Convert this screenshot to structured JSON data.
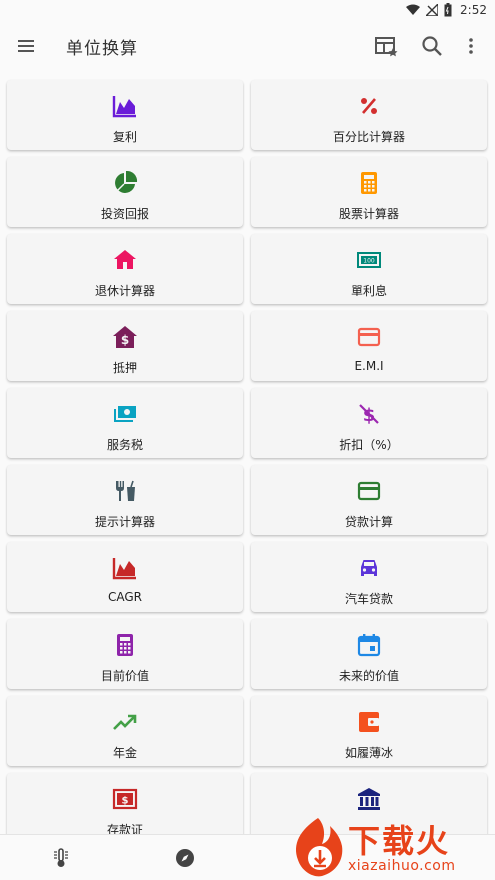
{
  "status_bar": {
    "time": "2:52"
  },
  "app_bar": {
    "title": "单位换算"
  },
  "colors": {
    "accent_purple": "#6a1cd8",
    "red": "#d32f2f",
    "orange": "#ff9800",
    "green": "#2e7d32",
    "teal": "#00897b",
    "pink": "#ec1561"
  },
  "cards": [
    {
      "label": "复利",
      "icon": "chart-area-icon"
    },
    {
      "label": "百分比计算器",
      "icon": "percent-icon"
    },
    {
      "label": "投资回报",
      "icon": "pie-chart-icon"
    },
    {
      "label": "股票计算器",
      "icon": "calculator-icon"
    },
    {
      "label": "退休计算器",
      "icon": "house-icon"
    },
    {
      "label": "單利息",
      "icon": "banknote-icon"
    },
    {
      "label": "抵押",
      "icon": "house-dollar-icon"
    },
    {
      "label": "E.M.I",
      "icon": "credit-card-icon"
    },
    {
      "label": "服务税",
      "icon": "cash-icon"
    },
    {
      "label": "折扣（%）",
      "icon": "dollar-off-icon"
    },
    {
      "label": "提示计算器",
      "icon": "restaurant-icon"
    },
    {
      "label": "贷款计算",
      "icon": "card-icon"
    },
    {
      "label": "CAGR",
      "icon": "chart-area-red-icon"
    },
    {
      "label": "汽车贷款",
      "icon": "car-icon"
    },
    {
      "label": "目前价值",
      "icon": "calculator-purple-icon"
    },
    {
      "label": "未来的价值",
      "icon": "calendar-icon"
    },
    {
      "label": "年金",
      "icon": "trending-up-icon"
    },
    {
      "label": "如履薄冰",
      "icon": "wallet-icon"
    },
    {
      "label": "存款证",
      "icon": "certificate-icon"
    },
    {
      "label": "",
      "icon": "bank-icon"
    }
  ],
  "watermark": {
    "text": "下载火",
    "url": "xiazaihuo.com"
  }
}
